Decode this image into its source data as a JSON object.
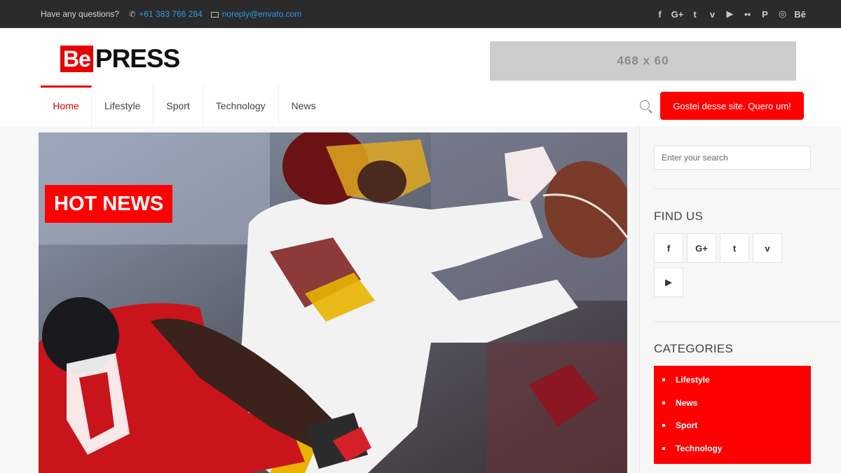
{
  "topbar": {
    "question": "Have any questions?",
    "phone": "+61 383 766 284",
    "email": "noreply@envato.com",
    "social_icons": [
      "f",
      "G+",
      "t",
      "v",
      "▶",
      "••",
      "P",
      "◎",
      "Bē"
    ]
  },
  "header": {
    "logo_be": "Be",
    "logo_press": "PRESS",
    "banner": "468 x 60",
    "cta": "Gostei desse site. Quero um!"
  },
  "nav": {
    "items": [
      {
        "label": "Home"
      },
      {
        "label": "Lifestyle"
      },
      {
        "label": "Sport"
      },
      {
        "label": "Technology"
      },
      {
        "label": "News"
      }
    ]
  },
  "hero": {
    "badge": "HOT NEWS"
  },
  "sidebar": {
    "search_placeholder": "Enter your search",
    "find_us_title": "FIND US",
    "find_us_icons": [
      "f",
      "G+",
      "t",
      "v",
      "▶"
    ],
    "categories_title": "CATEGORIES",
    "categories": [
      "Lifestyle",
      "News",
      "Sport",
      "Technology"
    ]
  },
  "colors": {
    "accent": "#ff0000",
    "topbar_bg": "#2b2b2b",
    "link": "#2e9be6"
  }
}
